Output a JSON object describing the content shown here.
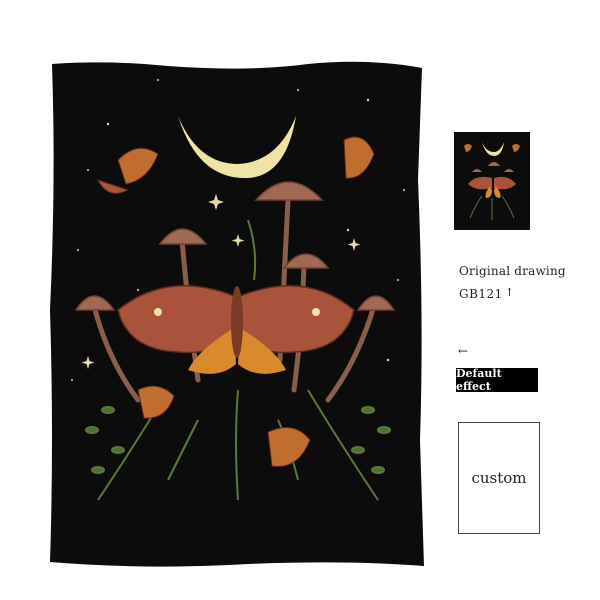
{
  "product": {
    "image_alt_icon": "moth-mushroom-moon-tapestry"
  },
  "options": {
    "original_label": "Original drawing",
    "code": "GB121",
    "code_arrow": "↑",
    "pointer_arrow": "←",
    "default_effect_label": "Default effect",
    "custom_label": "custom"
  },
  "colors": {
    "tapestry_background": "#0c0c0c",
    "moon": "#efe3a6",
    "moth_wing": "#a8533a",
    "moth_orange": "#d88a2c",
    "mushroom_cap": "#a06a52",
    "leaf": "#5a7a3a",
    "button_bg": "#000000",
    "button_text": "#ffffff"
  }
}
